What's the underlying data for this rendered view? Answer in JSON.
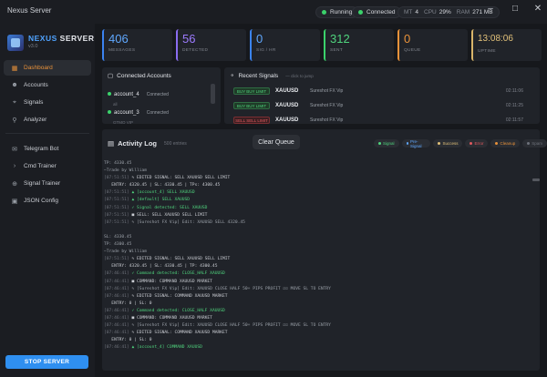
{
  "window": {
    "title": "Nexus Server"
  },
  "status": {
    "running": "Running",
    "connected": "Connected",
    "mt_label": "MT",
    "mt_value": "4",
    "cpu_label": "CPU",
    "cpu_value": "29%",
    "ram_label": "RAM",
    "ram_value": "271 MB"
  },
  "brand": {
    "name1": "NEXUS",
    "name2": "SERVER",
    "version": "v3.0"
  },
  "nav": [
    {
      "label": "Dashboard",
      "icon": "dashboard-icon"
    },
    {
      "label": "Accounts",
      "icon": "accounts-icon"
    },
    {
      "label": "Signals",
      "icon": "signals-icon"
    },
    {
      "label": "Analyzer",
      "icon": "analyzer-icon"
    },
    {
      "label": "Telegram Bot",
      "icon": "telegram-icon"
    },
    {
      "label": "Cmd Trainer",
      "icon": "terminal-icon"
    },
    {
      "label": "Signal Trainer",
      "icon": "signal-trainer-icon"
    },
    {
      "label": "JSON Config",
      "icon": "json-icon"
    }
  ],
  "stop_button": "STOP SERVER",
  "cards": [
    {
      "value": "406",
      "label": "MESSAGES",
      "color": "#5fa8ff"
    },
    {
      "value": "56",
      "label": "DETECTED",
      "color": "#9d7bff"
    },
    {
      "value": "0",
      "label": "SIG / HR",
      "color": "#5fa8ff"
    },
    {
      "value": "312",
      "label": "SENT",
      "color": "#4fd37d"
    },
    {
      "value": "0",
      "label": "QUEUE",
      "color": "#e9923a"
    },
    {
      "value": "13:08:06",
      "label": "UPTIME",
      "color": "#e3c27a"
    }
  ],
  "connected": {
    "title": "Connected Accounts",
    "accounts": [
      {
        "name": "account_4",
        "status": "Connected",
        "sub": "all"
      },
      {
        "name": "account_3",
        "status": "Connected",
        "sub": "GTMO VIP"
      }
    ]
  },
  "recent": {
    "title": "Recent Signals",
    "hint": "— click to jump",
    "items": [
      {
        "tag": "BUY BUY LIMIT",
        "symbol": "XAUUSD",
        "source": "Sureshot FX Vip",
        "time": "02:11:06",
        "red": false
      },
      {
        "tag": "BUY BUY LIMIT",
        "symbol": "XAUUSD",
        "source": "Sureshot FX Vip",
        "time": "02:11:25",
        "red": false
      },
      {
        "tag": "SELL SELL LIMIT",
        "symbol": "XAUUSD",
        "source": "Sureshot FX Vip",
        "time": "02:11:57",
        "red": true
      }
    ]
  },
  "activity": {
    "title": "Activity Log",
    "count": "500 entries",
    "clear_label": "Clear Queue",
    "filters": [
      {
        "label": "Signal",
        "color": "#4fd37d"
      },
      {
        "label": "Pre-Signal",
        "color": "#5fa8ff"
      },
      {
        "label": "Success",
        "color": "#e3c27a"
      },
      {
        "label": "Error",
        "color": "#e25a5f"
      },
      {
        "label": "Cleanup",
        "color": "#e9923a"
      },
      {
        "label": "Spam",
        "color": "#6e727b"
      }
    ],
    "lines": [
      {
        "ts": "",
        "text": "TP: 4330.45",
        "cls": "m"
      },
      {
        "ts": "",
        "text": "—Trade by William",
        "cls": "m"
      },
      {
        "ts": "[07:51:51]",
        "text": "✎ EDITED SIGNAL: SELL XAUUSD SELL LIMIT",
        "cls": ""
      },
      {
        "ts": "",
        "text": "   ENTRY: 4320.45 | SL: 4330.45 | TPs: 4300.45",
        "cls": ""
      },
      {
        "ts": "[07:51:51]",
        "text": "▲ [account_4] SELL XAUUSD",
        "cls": "g"
      },
      {
        "ts": "[07:51:51]",
        "text": "▲ [default] SELL XAUUSD",
        "cls": "g"
      },
      {
        "ts": "[07:51:51]",
        "text": "✓ Signal detected: SELL XAUUSD",
        "cls": "g"
      },
      {
        "ts": "[07:51:51]",
        "text": "■ SELL: SELL XAUUSD SELL LIMIT",
        "cls": ""
      },
      {
        "ts": "[07:51:51]",
        "text": "✎ [Sureshot FX Vip] Edit: XAUUSD SELL 4320.45",
        "cls": "m"
      },
      {
        "ts": "",
        "text": "",
        "cls": ""
      },
      {
        "ts": "",
        "text": "SL: 4330.45",
        "cls": "m"
      },
      {
        "ts": "",
        "text": "TP: 4300.45",
        "cls": "m"
      },
      {
        "ts": "",
        "text": "—Trade by William",
        "cls": "m"
      },
      {
        "ts": "[07:51:51]",
        "text": "✎ EDITED SIGNAL: SELL XAUUSD SELL LIMIT",
        "cls": ""
      },
      {
        "ts": "",
        "text": "   ENTRY: 4320.45 | SL: 4330.45 | TP: 4300.45",
        "cls": ""
      },
      {
        "ts": "[07:46:41]",
        "text": "✓ Command detected: CLOSE_HALF XAUUSD",
        "cls": "g"
      },
      {
        "ts": "[07:46:41]",
        "text": "■ COMMAND: COMMAND XAUUSD MARKET",
        "cls": ""
      },
      {
        "ts": "[07:46:41]",
        "text": "✎ [Sureshot FX Vip] Edit: XAUUSD CLOSE HALF 50+ PIPS PROFIT ☑☑ MOVE SL TO ENTRY",
        "cls": "m"
      },
      {
        "ts": "[07:46:41]",
        "text": "✎ EDITED SIGNAL: COMMAND XAUUSD MARKET",
        "cls": ""
      },
      {
        "ts": "",
        "text": "   ENTRY: 0 | SL: 0",
        "cls": ""
      },
      {
        "ts": "[07:46:41]",
        "text": "✓ Command detected: CLOSE_HALF XAUUSD",
        "cls": "g"
      },
      {
        "ts": "[07:46:41]",
        "text": "■ COMMAND: COMMAND XAUUSD MARKET",
        "cls": ""
      },
      {
        "ts": "[07:46:41]",
        "text": "✎ [Sureshot FX Vip] Edit: XAUUSD CLOSE HALF 50+ PIPS PROFIT ☑☑ MOVE SL TO ENTRY",
        "cls": "m"
      },
      {
        "ts": "[07:46:41]",
        "text": "✎ EDITED SIGNAL: COMMAND XAUUSD MARKET",
        "cls": ""
      },
      {
        "ts": "",
        "text": "   ENTRY: 0 | SL: 0",
        "cls": ""
      },
      {
        "ts": "[07:46:41]",
        "text": "▲ [account_4] COMMAND XAUUSD",
        "cls": "g"
      }
    ]
  }
}
